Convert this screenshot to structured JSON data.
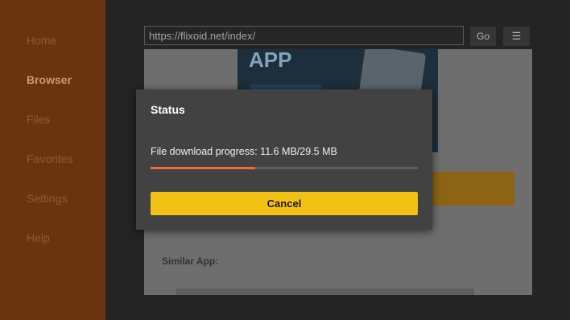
{
  "sidebar": {
    "items": [
      {
        "label": "Home"
      },
      {
        "label": "Browser"
      },
      {
        "label": "Files"
      },
      {
        "label": "Favorites"
      },
      {
        "label": "Settings"
      },
      {
        "label": "Help"
      }
    ],
    "active": "Browser"
  },
  "toolbar": {
    "url": "https://flixoid.net/index/",
    "go_label": "Go",
    "menu_icon": "hamburger-menu-icon"
  },
  "web": {
    "banner_text": "APP",
    "similar_label": "Similar App:"
  },
  "dialog": {
    "title": "Status",
    "message": "File download progress: 11.6 MB/29.5 MB",
    "progress_fraction": 0.393,
    "cancel_label": "Cancel"
  },
  "colors": {
    "sidebar_bg": "#6b3410",
    "accent": "#f3c114",
    "progress": "#ef6c36",
    "dialog_bg": "#424242"
  }
}
